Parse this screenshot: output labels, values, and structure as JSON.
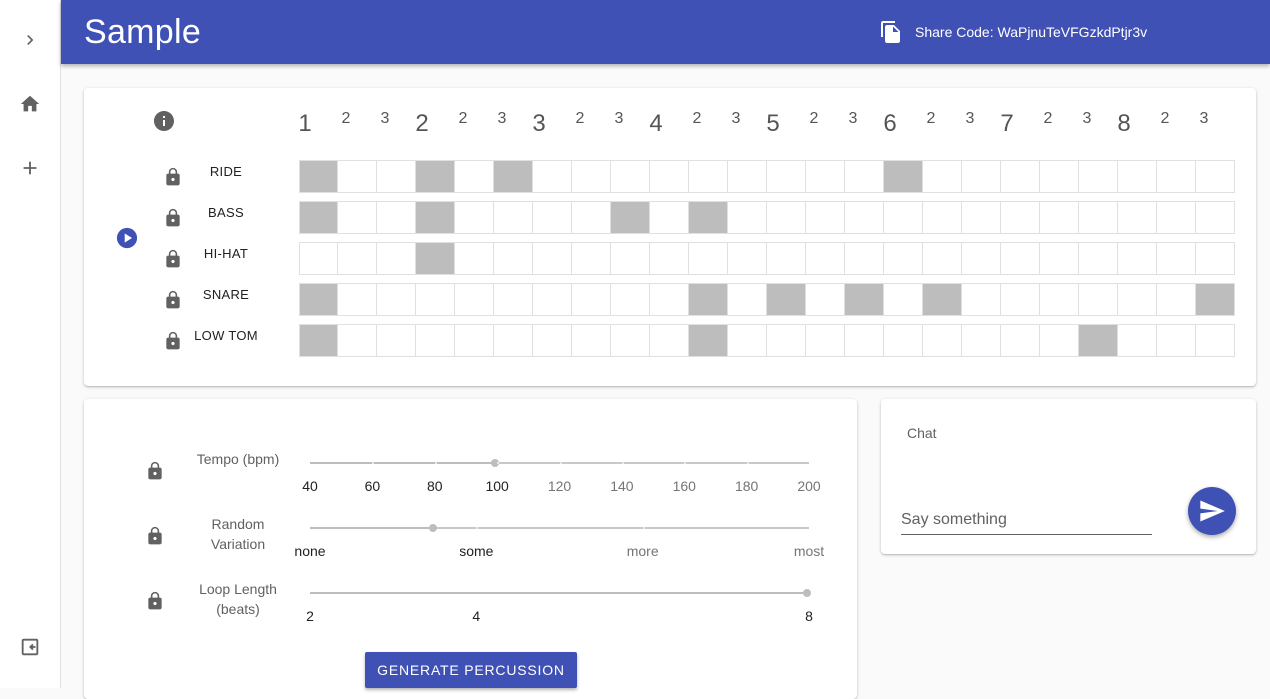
{
  "app": {
    "title": "Sample",
    "share_label": "Share Code: WaPjnuTeVFGzkdPtjr3v"
  },
  "sidenav": {
    "icons": [
      "chevron-right-icon",
      "home-icon",
      "plus-icon",
      "exit-icon"
    ]
  },
  "sequencer": {
    "beat_labels": [
      "1",
      "2",
      "3",
      "2",
      "2",
      "3",
      "3",
      "2",
      "3",
      "4",
      "2",
      "3",
      "5",
      "2",
      "3",
      "6",
      "2",
      "3",
      "7",
      "2",
      "3",
      "8",
      "2",
      "3"
    ],
    "tracks": [
      {
        "name": "RIDE",
        "on": [
          0,
          3,
          5,
          15
        ]
      },
      {
        "name": "BASS",
        "on": [
          0,
          3,
          8,
          10
        ]
      },
      {
        "name": "HI-HAT",
        "on": [
          3
        ]
      },
      {
        "name": "SNARE",
        "on": [
          0,
          10,
          12,
          14,
          16,
          23
        ]
      },
      {
        "name": "LOW TOM",
        "on": [
          0,
          10,
          20
        ]
      }
    ]
  },
  "controls": {
    "tempo": {
      "label": "Tempo (bpm)",
      "marks": [
        "40",
        "60",
        "80",
        "100",
        "120",
        "140",
        "160",
        "180",
        "200"
      ],
      "value": 100
    },
    "variation": {
      "label": "Random Variation",
      "marks": [
        "none",
        "some",
        "more",
        "most"
      ],
      "value": "some"
    },
    "loop": {
      "label": "Loop Length (beats)",
      "marks": [
        "2",
        "4",
        "8"
      ],
      "value": "8"
    },
    "generate_label": "GENERATE PERCUSSION"
  },
  "chat": {
    "title": "Chat",
    "placeholder": "Say something"
  },
  "colors": {
    "primary": "#3f51b5",
    "cell_on": "#bdbdbd",
    "cell_off": "#ffffff"
  }
}
